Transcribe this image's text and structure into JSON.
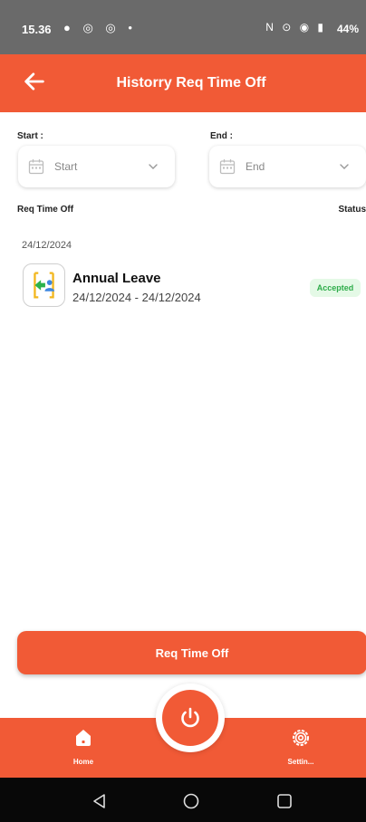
{
  "status_bar": {
    "time": "15.36",
    "left_icons": "● ◎ ◎ •",
    "right_icons": "N ⊙ ◉ ▮",
    "battery": "44%"
  },
  "app_bar": {
    "title": "Historry Req Time Off",
    "back_icon": "arrow-left-icon"
  },
  "filters": {
    "start_label": "Start :",
    "end_label": "End :",
    "start_value": "Start",
    "end_value": "End",
    "field_icon": "calendar-icon",
    "dropdown_icon": "chevron-down-icon"
  },
  "columns": {
    "left": "Req Time Off",
    "right": "Status"
  },
  "history": [
    {
      "date": "24/12/2024",
      "items": [
        {
          "type": "Annual Leave",
          "range": "24/12/2024 - 24/12/2024",
          "status": "Accepted",
          "status_color": "#2eac4a",
          "icon": "leave-icon"
        }
      ]
    }
  ],
  "actions": {
    "req_button": "Req Time Off"
  },
  "bottom_nav": {
    "home_label": "Home",
    "settings_label": "Settin...",
    "center_icon": "power-icon"
  },
  "colors": {
    "accent": "#f15a36",
    "status_bar": "#6a6a6a",
    "system_nav": "#080808"
  }
}
